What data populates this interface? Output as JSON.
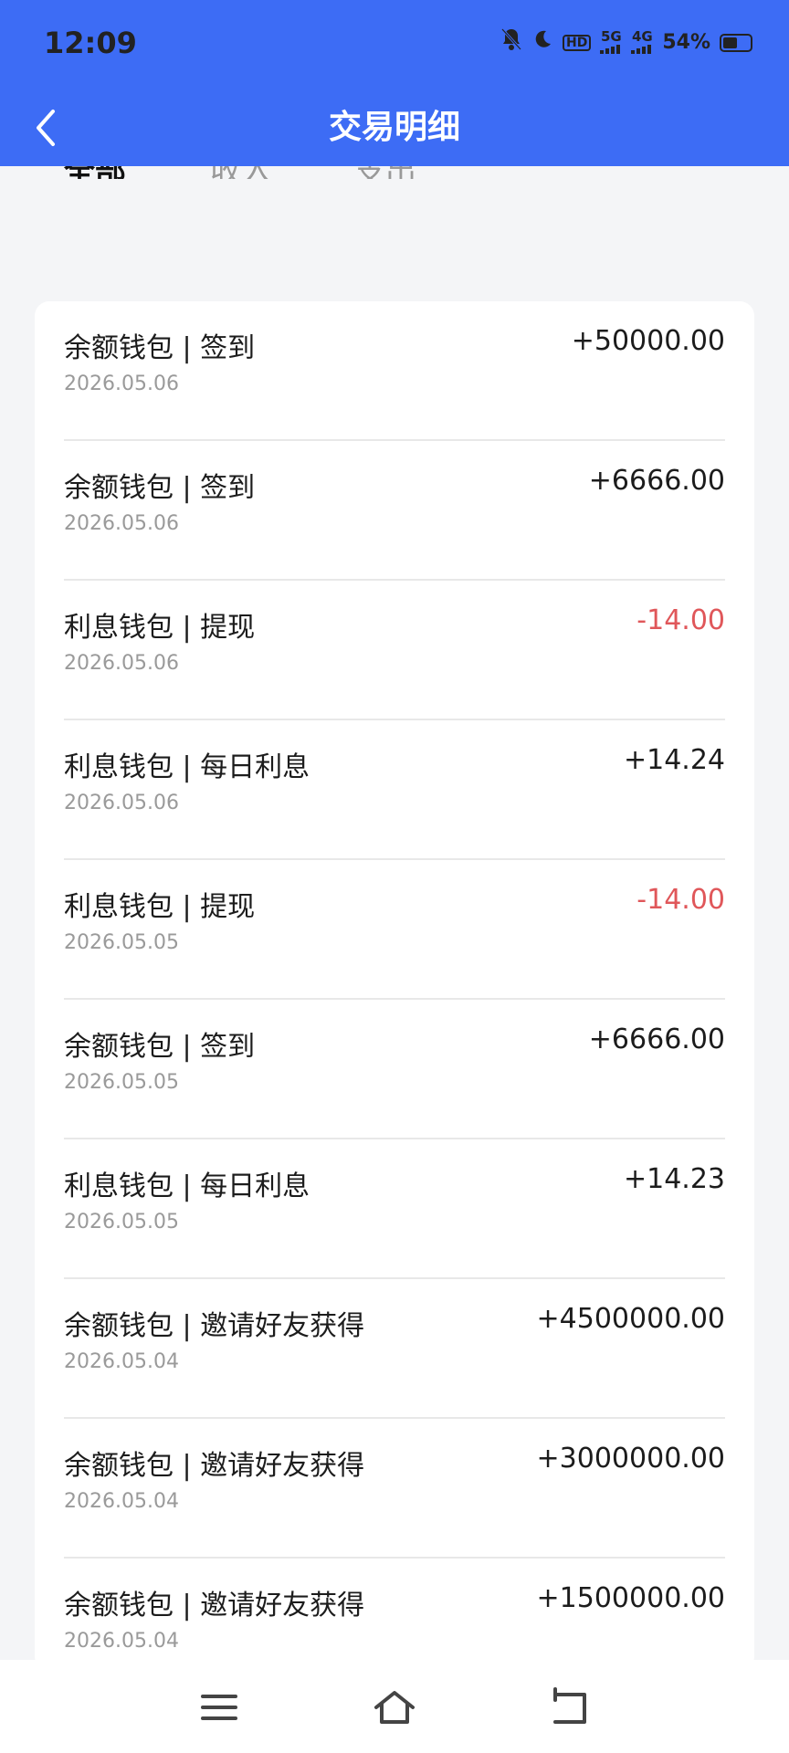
{
  "status_bar": {
    "time": "12:09",
    "net_5g": "5G",
    "net_4g": "4G",
    "hd": "HD",
    "battery_text": "54%",
    "battery_level": 0.54
  },
  "header": {
    "title": "交易明细",
    "accent_color": "#3d6cf5"
  },
  "tabs": [
    {
      "label": "全部",
      "active": true
    },
    {
      "label": "收入",
      "active": false
    },
    {
      "label": "支出",
      "active": false
    }
  ],
  "transactions": [
    {
      "title": "余额钱包 | 签到",
      "date": "2026.05.06",
      "amount": "+50000.00",
      "negative": false
    },
    {
      "title": "余额钱包 | 签到",
      "date": "2026.05.06",
      "amount": "+6666.00",
      "negative": false
    },
    {
      "title": "利息钱包 | 提现",
      "date": "2026.05.06",
      "amount": "-14.00",
      "negative": true
    },
    {
      "title": "利息钱包 | 每日利息",
      "date": "2026.05.06",
      "amount": "+14.24",
      "negative": false
    },
    {
      "title": "利息钱包 | 提现",
      "date": "2026.05.05",
      "amount": "-14.00",
      "negative": true
    },
    {
      "title": "余额钱包 | 签到",
      "date": "2026.05.05",
      "amount": "+6666.00",
      "negative": false
    },
    {
      "title": "利息钱包 | 每日利息",
      "date": "2026.05.05",
      "amount": "+14.23",
      "negative": false
    },
    {
      "title": "余额钱包 | 邀请好友获得",
      "date": "2026.05.04",
      "amount": "+4500000.00",
      "negative": false
    },
    {
      "title": "余额钱包 | 邀请好友获得",
      "date": "2026.05.04",
      "amount": "+3000000.00",
      "negative": false
    },
    {
      "title": "余额钱包 | 邀请好友获得",
      "date": "2026.05.04",
      "amount": "+1500000.00",
      "negative": false
    }
  ],
  "icons": {
    "back": "chevron-left-icon",
    "menu": "menu-icon",
    "home": "home-icon",
    "return": "return-icon"
  },
  "colors": {
    "negative_amount": "#e0575a"
  }
}
